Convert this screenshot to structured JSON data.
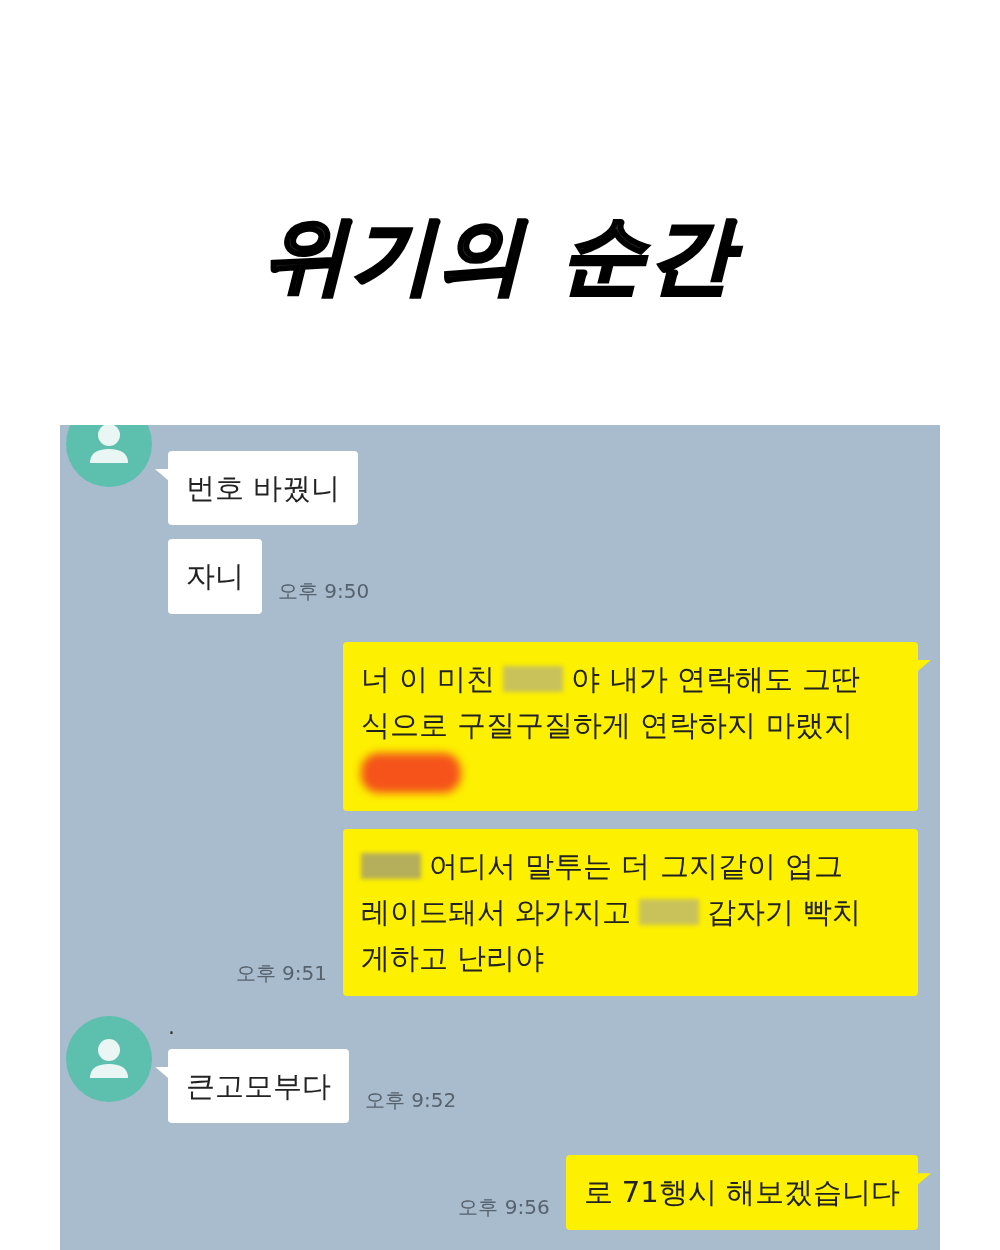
{
  "title": "위기의 순간",
  "messages": [
    {
      "kind": "incoming",
      "avatar": true,
      "lines": [
        [
          {
            "kind": "text",
            "text": "번호 바꿨니"
          }
        ]
      ]
    },
    {
      "kind": "incoming",
      "avatar": false,
      "lines": [
        [
          {
            "kind": "text",
            "text": "자니"
          }
        ]
      ],
      "time": "오후 9:50"
    },
    {
      "kind": "outgoing",
      "lines": [
        [
          {
            "kind": "text",
            "text": "너 이 미친"
          },
          {
            "kind": "censor",
            "color": "#c9c25a"
          },
          {
            "kind": "text",
            "text": "야 내가 연락해도 그딴"
          }
        ],
        [
          {
            "kind": "text",
            "text": "식으로 구질구질하게 연락하지 마랬지"
          }
        ],
        [
          {
            "kind": "censor",
            "color": "#f5531a",
            "block": true
          }
        ]
      ]
    },
    {
      "kind": "outgoing",
      "lines": [
        [
          {
            "kind": "censor",
            "color": "#b5ae5a"
          },
          {
            "kind": "text",
            "text": "어디서 말투는 더 그지같이 업그"
          }
        ],
        [
          {
            "kind": "text",
            "text": "레이드돼서 와가지고"
          },
          {
            "kind": "censor",
            "color": "#c9c25a"
          },
          {
            "kind": "text",
            "text": "갑자기 빡치"
          }
        ],
        [
          {
            "kind": "text",
            "text": "게하고 난리야"
          }
        ]
      ],
      "time": "오후 9:51"
    },
    {
      "kind": "incoming",
      "avatar": true,
      "sender": "·",
      "lines": [
        [
          {
            "kind": "text",
            "text": "큰고모부다"
          }
        ]
      ],
      "time": "오후 9:52"
    },
    {
      "kind": "outgoing",
      "lines": [
        [
          {
            "kind": "text",
            "text": "로 71행시 해보겠습니다"
          }
        ]
      ],
      "time": "오후 9:56"
    }
  ]
}
